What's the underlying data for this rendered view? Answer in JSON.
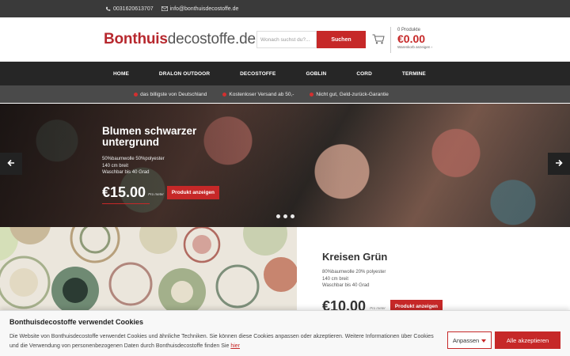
{
  "topbar": {
    "phone": "0031620613707",
    "email": "info@bonthuisdecostoffe.de"
  },
  "header": {
    "logo_brand": "Bonthuis",
    "logo_rest": "decostoffe.de",
    "search_placeholder": "Wonach suchst du?...",
    "search_button": "Suchen",
    "cart_count": "0 Produkte",
    "cart_total": "€0.00",
    "cart_show": "Warenkorb anzeigen ›"
  },
  "nav": {
    "items": [
      "HOME",
      "DRALON OUTDOOR",
      "DECOSTOFFE",
      "GOBLIN",
      "CORD",
      "TERMINE"
    ]
  },
  "benefits": [
    "das billigste von Deutschland",
    "Kostenloser Versand ab 50,-",
    "Nicht gut, Geld-zurück-Garantie"
  ],
  "slider": {
    "title": "Blumen schwarzer untergrund",
    "desc_lines": [
      "50%baumwolle 50%polyester",
      "140 cm breit",
      "Waschbar bis 40 Grad"
    ],
    "price": "€15.00",
    "per_meter": "Pro meter",
    "button": "Produkt anzeigen",
    "total_slides": 3
  },
  "product": {
    "title": "Kreisen Grün",
    "desc_lines": [
      "80%baumwolle 20% polyester",
      "140 cm breit",
      "Waschbar bis 40 Grad"
    ],
    "price": "€10.00",
    "per_meter": "Pro meter",
    "button": "Produkt anzeigen"
  },
  "cookie": {
    "title": "Bonthuisdecostoffe verwendet Cookies",
    "text": "Die Website von Bonthuisdecostoffe verwendet Cookies und ähnliche Techniken. Sie können diese Cookies anpassen oder akzeptieren. Weitere Informationen über Cookies und die Verwendung von personenbezogenen Daten durch Bonthuisdecostoffe finden Sie",
    "link": "hier",
    "adjust_button": "Anpassen",
    "accept_button": "Alle akzeptieren"
  },
  "colors": {
    "accent": "#c62828",
    "nav_bg": "#262626",
    "topbar_bg": "#3a3a3a"
  },
  "icons": [
    "phone-icon",
    "mail-icon",
    "cart-icon",
    "arrow-left-icon",
    "arrow-right-icon",
    "caret-down-icon"
  ]
}
